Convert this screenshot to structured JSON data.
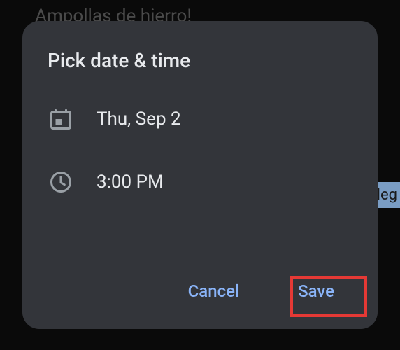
{
  "background": {
    "text_fragment": "Ampollas de hierro!",
    "tag_fragment": "leg"
  },
  "dialog": {
    "title": "Pick date & time",
    "date_row": {
      "label": "Thu, Sep 2"
    },
    "time_row": {
      "label": "3:00 PM"
    },
    "buttons": {
      "cancel": "Cancel",
      "save": "Save"
    }
  }
}
